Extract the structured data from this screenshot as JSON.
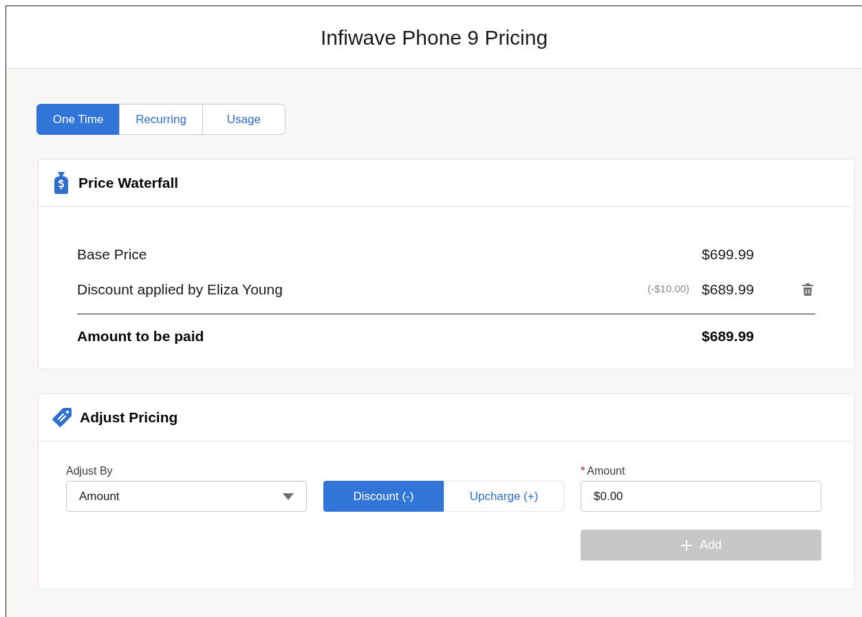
{
  "window": {
    "title": "Infiwave Phone 9 Pricing"
  },
  "tabs": [
    {
      "label": "One Time",
      "selected": true
    },
    {
      "label": "Recurring",
      "selected": false
    },
    {
      "label": "Usage",
      "selected": false
    }
  ],
  "price_waterfall": {
    "title": "Price Waterfall",
    "rows": [
      {
        "label": "Base Price",
        "value": "$699.99",
        "deletable": false
      },
      {
        "label": "Discount applied by Eliza Young",
        "adjustment": "(-$10.00)",
        "value": "$689.99",
        "deletable": true
      }
    ],
    "total": {
      "label": "Amount to be paid",
      "value": "$689.99"
    }
  },
  "adjust_pricing": {
    "title": "Adjust Pricing",
    "adjust_by": {
      "label": "Adjust By",
      "value": "Amount"
    },
    "direction": [
      {
        "label": "Discount (-)",
        "selected": true
      },
      {
        "label": "Upcharge (+)",
        "selected": false
      }
    ],
    "amount": {
      "required_mark": "*",
      "label": "Amount",
      "value": "$0.00"
    },
    "add_button": {
      "label": "Add",
      "disabled": true
    }
  }
}
